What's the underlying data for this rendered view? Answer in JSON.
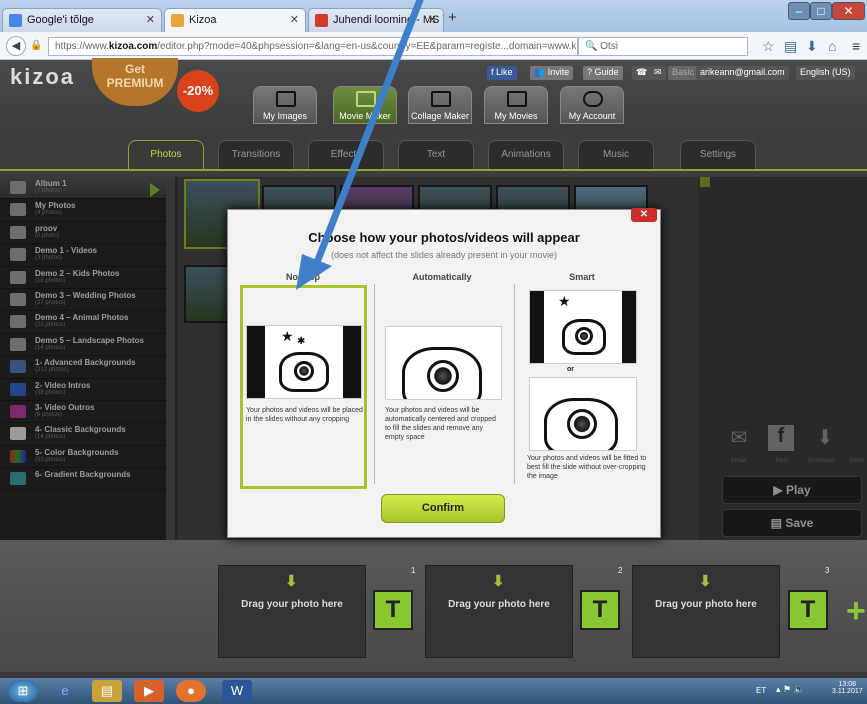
{
  "browser": {
    "tabs": [
      {
        "label": "Google'i tõlge",
        "fav_color": "#4a86e8"
      },
      {
        "label": "Kizoa",
        "fav_color": "#e8a33a"
      },
      {
        "label": "Juhendi loomine - MS Wor...",
        "fav_color": "#d03b2b"
      }
    ],
    "new_tab": "+",
    "url_prefix": "https://www.",
    "url_domain": "kizoa.com",
    "url_rest": "/editor.php?mode=40&phpsession=&lang=en-us&country=EE&param=registe...domain=www.kiz",
    "search_placeholder": "Otsi",
    "window_controls": [
      "–",
      "□",
      "✕"
    ]
  },
  "app": {
    "logo": "kizoa",
    "promo_line1": "Get",
    "promo_line2": "PREMIUM",
    "promo_discount": "-20%",
    "nav_tiles": [
      "My Images",
      "Movie Maker",
      "Collage Maker",
      "My Movies",
      "My Account"
    ],
    "social": {
      "like": "Like",
      "invite": "Invite",
      "guide": "Guide",
      "basic": "Basic",
      "account_email": "arikeann@gmail.com",
      "language": "English (US)"
    },
    "editor_tabs": [
      "Photos",
      "Transitions",
      "Effects",
      "Text",
      "Animations",
      "Music",
      "Settings"
    ]
  },
  "albums": [
    {
      "name": "Album 1",
      "count": "(7 photos)"
    },
    {
      "name": "My Photos",
      "count": "(4 photos)"
    },
    {
      "name": "proov",
      "count": "(0 photo)"
    },
    {
      "name": "Demo 1 - Videos",
      "count": "(3 photos)"
    },
    {
      "name": "Demo 2 – Kids Photos",
      "count": "(18 photos)"
    },
    {
      "name": "Demo 3 – Wedding Photos",
      "count": "(27 photos)"
    },
    {
      "name": "Demo 4 – Animal Photos",
      "count": "(22 photos)"
    },
    {
      "name": "Demo 5 – Landscape Photos",
      "count": "(14 photos)"
    },
    {
      "name": "1- Advanced Backgrounds",
      "count": "(212 photos)"
    },
    {
      "name": "2- Video Intros",
      "count": "(38 photos)"
    },
    {
      "name": "3- Video Outros",
      "count": "(6 photos)"
    },
    {
      "name": "4- Classic Backgrounds",
      "count": "(14 photos)"
    },
    {
      "name": "5- Color Backgrounds",
      "count": "(53 photos)"
    },
    {
      "name": "6- Gradient Backgrounds",
      "count": ""
    }
  ],
  "right_panel": {
    "share": [
      "Email",
      "Post",
      "Download",
      "More"
    ],
    "play": "Play",
    "save": "Save"
  },
  "timeline": {
    "slots": [
      {
        "num": "1",
        "label": "Drag your photo here"
      },
      {
        "num": "2",
        "label": "Drag your photo here"
      },
      {
        "num": "3",
        "label": "Drag your photo here"
      }
    ],
    "text_button": "T"
  },
  "modal": {
    "title": "Choose how your photos/videos will appear",
    "subtitle": "(does not affect the slides already present in your movie)",
    "options": [
      {
        "label": "No crop",
        "desc": "Your photos and videos will be placed in the slides without any cropping"
      },
      {
        "label": "Automatically",
        "desc": "Your photos and videos will be automatically centered and cropped to fill the slides and remove any empty space"
      },
      {
        "label": "Smart",
        "desc": "Your photos and videos will be fitted to best fill the slide without over-cropping the image"
      }
    ],
    "or_label": "or",
    "confirm": "Confirm",
    "close": "✕"
  },
  "taskbar": {
    "lang": "ET",
    "time": "13:08",
    "date": "3.11.2017"
  },
  "colors": {
    "accent_green": "#a5c42b",
    "arrow_blue": "#3f7fc9",
    "promo_orange": "#d9431c"
  }
}
